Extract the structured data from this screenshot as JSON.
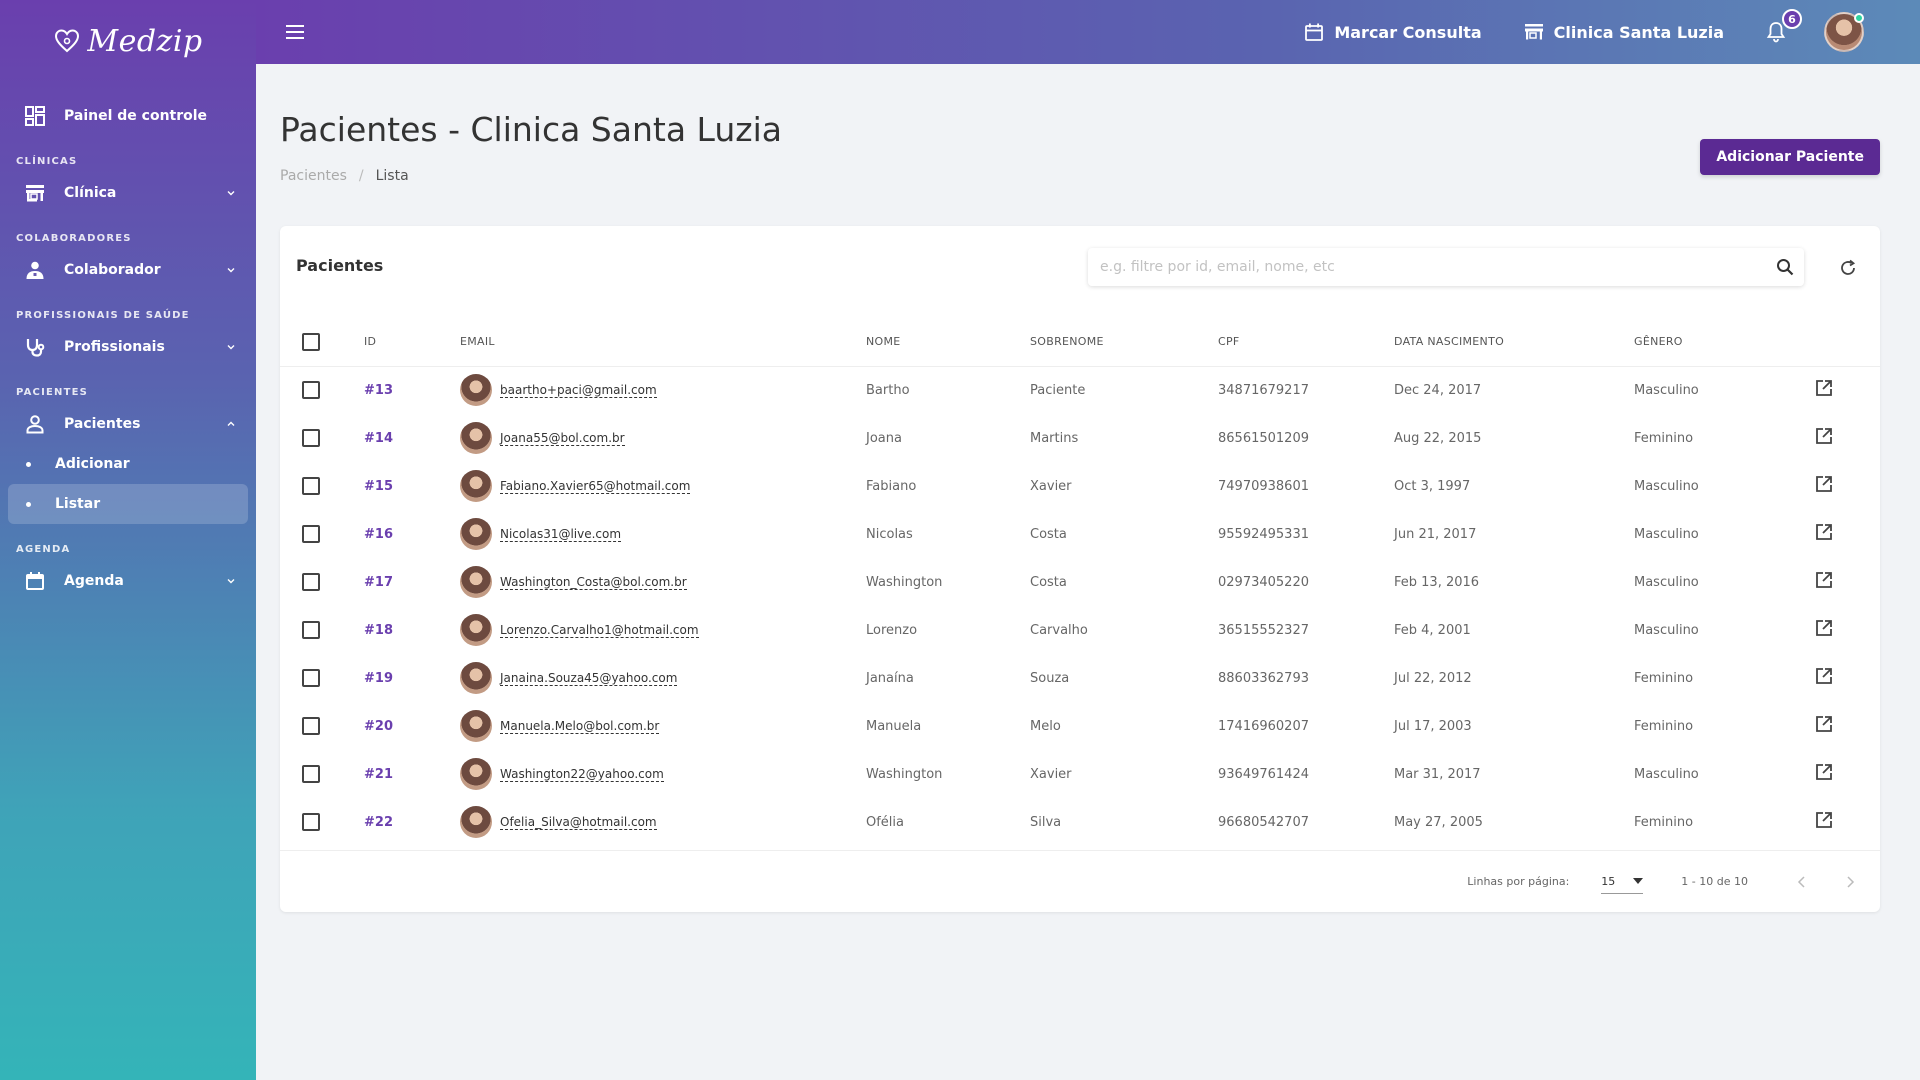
{
  "brand": {
    "name": "Medzip"
  },
  "sidebar": {
    "dashboard": "Painel de controle",
    "sections": [
      {
        "title": "CLÍNICAS",
        "item": "Clínica"
      },
      {
        "title": "COLABORADORES",
        "item": "Colaborador"
      },
      {
        "title": "PROFISSIONAIS DE SAÚDE",
        "item": "Profissionais"
      },
      {
        "title": "PACIENTES",
        "item": "Pacientes"
      },
      {
        "title": "AGENDA",
        "item": "Agenda"
      }
    ],
    "sub_items": [
      "Adicionar",
      "Listar"
    ]
  },
  "topbar": {
    "schedule_label": "Marcar Consulta",
    "clinic_label": "Clinica Santa Luzia",
    "notifications": "6"
  },
  "page": {
    "title": "Pacientes - Clinica Santa Luzia",
    "breadcrumb": [
      "Pacientes",
      "Lista"
    ],
    "add_button": "Adicionar Paciente"
  },
  "card": {
    "title": "Pacientes",
    "search_placeholder": "e.g. filtre por id, email, nome, etc",
    "columns": [
      "ID",
      "EMAIL",
      "NOME",
      "SOBRENOME",
      "CPF",
      "DATA NASCIMENTO",
      "GÊNERO"
    ],
    "rows": [
      {
        "id": "#13",
        "email": "baartho+paci@gmail.com",
        "nome": "Bartho",
        "sobrenome": "Paciente",
        "cpf": "34871679217",
        "nascimento": "Dec 24, 2017",
        "genero": "Masculino"
      },
      {
        "id": "#14",
        "email": "Joana55@bol.com.br",
        "nome": "Joana",
        "sobrenome": "Martins",
        "cpf": "86561501209",
        "nascimento": "Aug 22, 2015",
        "genero": "Feminino"
      },
      {
        "id": "#15",
        "email": "Fabiano.Xavier65@hotmail.com",
        "nome": "Fabiano",
        "sobrenome": "Xavier",
        "cpf": "74970938601",
        "nascimento": "Oct 3, 1997",
        "genero": "Masculino"
      },
      {
        "id": "#16",
        "email": "Nicolas31@live.com",
        "nome": "Nicolas",
        "sobrenome": "Costa",
        "cpf": "95592495331",
        "nascimento": "Jun 21, 2017",
        "genero": "Masculino"
      },
      {
        "id": "#17",
        "email": "Washington_Costa@bol.com.br",
        "nome": "Washington",
        "sobrenome": "Costa",
        "cpf": "02973405220",
        "nascimento": "Feb 13, 2016",
        "genero": "Masculino"
      },
      {
        "id": "#18",
        "email": "Lorenzo.Carvalho1@hotmail.com",
        "nome": "Lorenzo",
        "sobrenome": "Carvalho",
        "cpf": "36515552327",
        "nascimento": "Feb 4, 2001",
        "genero": "Masculino"
      },
      {
        "id": "#19",
        "email": "Janaina.Souza45@yahoo.com",
        "nome": "Janaína",
        "sobrenome": "Souza",
        "cpf": "88603362793",
        "nascimento": "Jul 22, 2012",
        "genero": "Feminino"
      },
      {
        "id": "#20",
        "email": "Manuela.Melo@bol.com.br",
        "nome": "Manuela",
        "sobrenome": "Melo",
        "cpf": "17416960207",
        "nascimento": "Jul 17, 2003",
        "genero": "Feminino"
      },
      {
        "id": "#21",
        "email": "Washington22@yahoo.com",
        "nome": "Washington",
        "sobrenome": "Xavier",
        "cpf": "93649761424",
        "nascimento": "Mar 31, 2017",
        "genero": "Masculino"
      },
      {
        "id": "#22",
        "email": "Ofelia_Silva@hotmail.com",
        "nome": "Ofélia",
        "sobrenome": "Silva",
        "cpf": "96680542707",
        "nascimento": "May 27, 2005",
        "genero": "Feminino"
      }
    ],
    "footer": {
      "rows_per_page_label": "Linhas por página:",
      "rows_per_page_value": "15",
      "range": "1 - 10 de 10"
    }
  },
  "colors": {
    "primary": "#5b2a93",
    "accent": "#6a3fae",
    "sidebar_bottom": "#34b4b8"
  }
}
